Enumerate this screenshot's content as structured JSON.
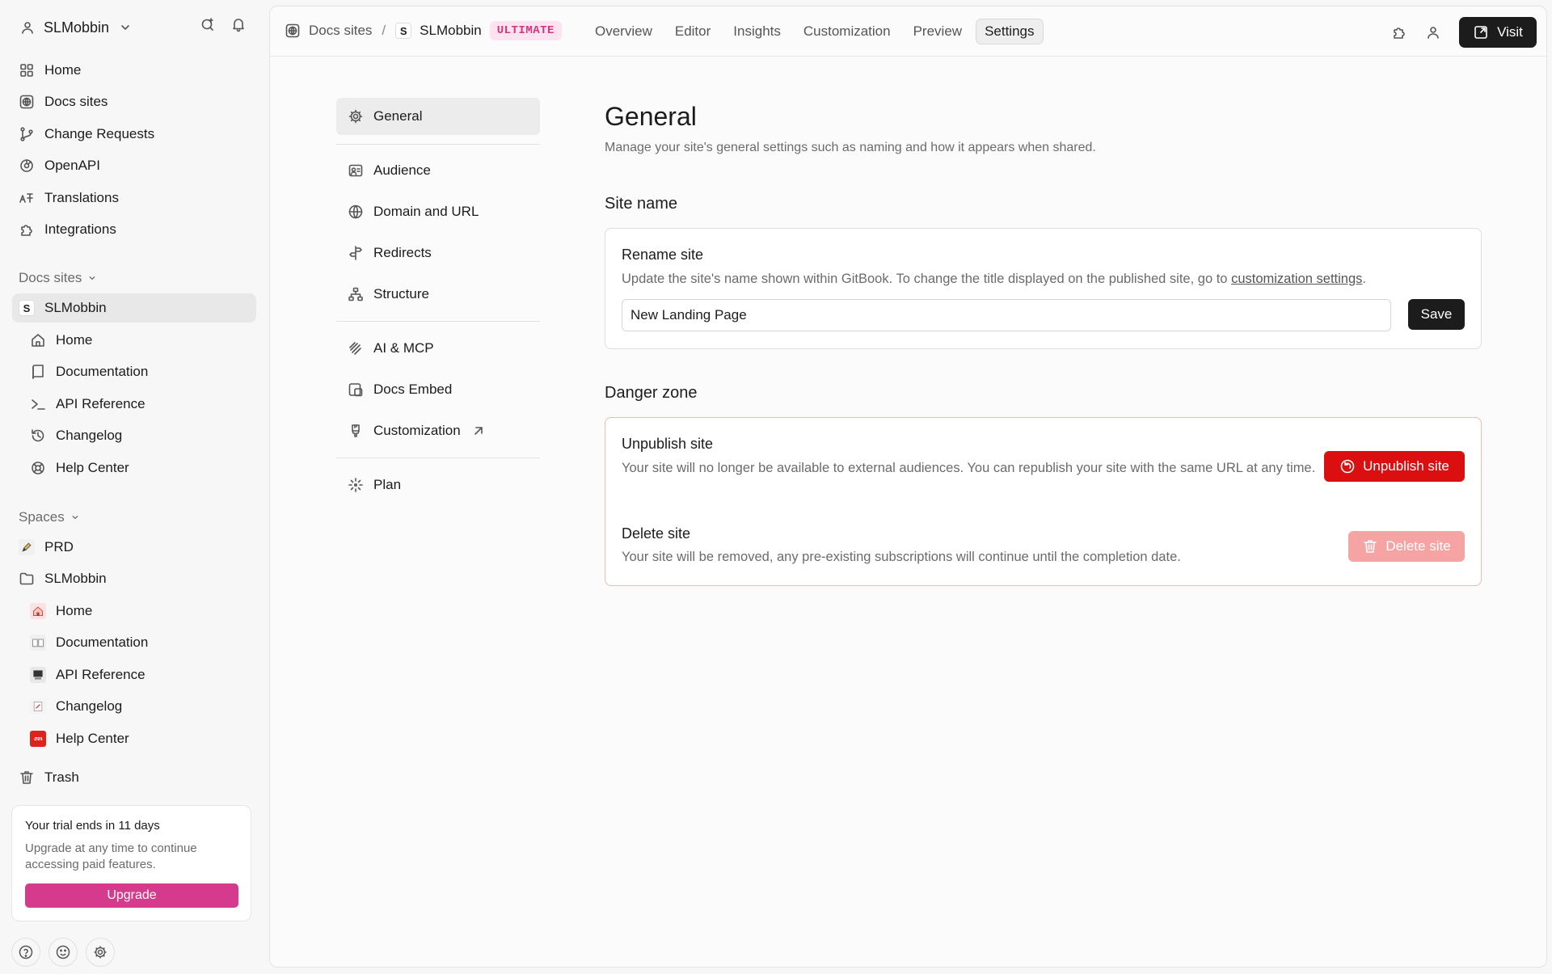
{
  "workspace": {
    "name": "SLMobbin"
  },
  "sidebar": {
    "main_items": [
      {
        "label": "Home",
        "icon": "grid-icon"
      },
      {
        "label": "Docs sites",
        "icon": "globe-icon"
      },
      {
        "label": "Change Requests",
        "icon": "branch-icon"
      },
      {
        "label": "OpenAPI",
        "icon": "openapi-icon"
      },
      {
        "label": "Translations",
        "icon": "translate-icon"
      },
      {
        "label": "Integrations",
        "icon": "puzzle-icon"
      }
    ],
    "docs_sites_header": "Docs sites",
    "site": {
      "badge": "S",
      "name": "SLMobbin"
    },
    "site_items": [
      {
        "label": "Home",
        "icon": "house-icon"
      },
      {
        "label": "Documentation",
        "icon": "book-icon"
      },
      {
        "label": "API Reference",
        "icon": "terminal-icon"
      },
      {
        "label": "Changelog",
        "icon": "history-icon"
      },
      {
        "label": "Help Center",
        "icon": "lifebuoy-icon"
      }
    ],
    "spaces_header": "Spaces",
    "spaces": [
      {
        "label": "PRD",
        "icon": "pencil-emoji-icon",
        "indent": false
      },
      {
        "label": "SLMobbin",
        "icon": "folder-icon",
        "indent": false
      },
      {
        "label": "Home",
        "icon": "house-emoji-icon",
        "indent": true
      },
      {
        "label": "Documentation",
        "icon": "book-emoji-icon",
        "indent": true
      },
      {
        "label": "API Reference",
        "icon": "computer-emoji-icon",
        "indent": true
      },
      {
        "label": "Changelog",
        "icon": "memo-emoji-icon",
        "indent": true
      },
      {
        "label": "Help Center",
        "icon": "sos-emoji-icon",
        "indent": true
      }
    ],
    "trash": "Trash",
    "trial": {
      "title": "Your trial ends in 11 days",
      "desc": "Upgrade at any time to continue accessing paid features.",
      "button": "Upgrade"
    }
  },
  "topbar": {
    "breadcrumb_root": "Docs sites",
    "separator": "/",
    "site_badge": "S",
    "site_name": "SLMobbin",
    "plan_badge": "ULTIMATE",
    "tabs": [
      "Overview",
      "Editor",
      "Insights",
      "Customization",
      "Preview",
      "Settings"
    ],
    "active_tab": "Settings",
    "visit_label": "Visit"
  },
  "settings_nav": {
    "groups": [
      [
        {
          "label": "General",
          "icon": "gear-icon",
          "active": true
        }
      ],
      [
        {
          "label": "Audience",
          "icon": "audience-icon"
        },
        {
          "label": "Domain and URL",
          "icon": "globe-icon"
        },
        {
          "label": "Redirects",
          "icon": "signpost-icon"
        },
        {
          "label": "Structure",
          "icon": "sitemap-icon"
        }
      ],
      [
        {
          "label": "AI & MCP",
          "icon": "ai-icon"
        },
        {
          "label": "Docs Embed",
          "icon": "embed-icon"
        },
        {
          "label": "Customization",
          "icon": "brush-icon",
          "external": true
        }
      ],
      [
        {
          "label": "Plan",
          "icon": "sparkle-icon"
        }
      ]
    ]
  },
  "content": {
    "title": "General",
    "description": "Manage your site's general settings such as naming and how it appears when shared.",
    "site_name": {
      "heading": "Site name",
      "card_title": "Rename site",
      "card_desc_prefix": "Update the site's name shown within GitBook. To change the title displayed on the published site, go to ",
      "card_desc_link": "customization settings",
      "card_desc_suffix": ".",
      "input_value": "New Landing Page",
      "save_label": "Save"
    },
    "danger": {
      "heading": "Danger zone",
      "unpublish_title": "Unpublish site",
      "unpublish_desc": "Your site will no longer be available to external audiences. You can republish your site with the same URL at any time.",
      "unpublish_button": "Unpublish site",
      "delete_title": "Delete site",
      "delete_desc": "Your site will be removed, any pre-existing subscriptions will continue until the completion date.",
      "delete_button": "Delete site"
    }
  },
  "colors": {
    "accent_pink": "#d63a8c",
    "danger_red": "#dc0f10",
    "danger_disabled": "#f5a3a3",
    "dark_button": "#1c1c1c"
  }
}
